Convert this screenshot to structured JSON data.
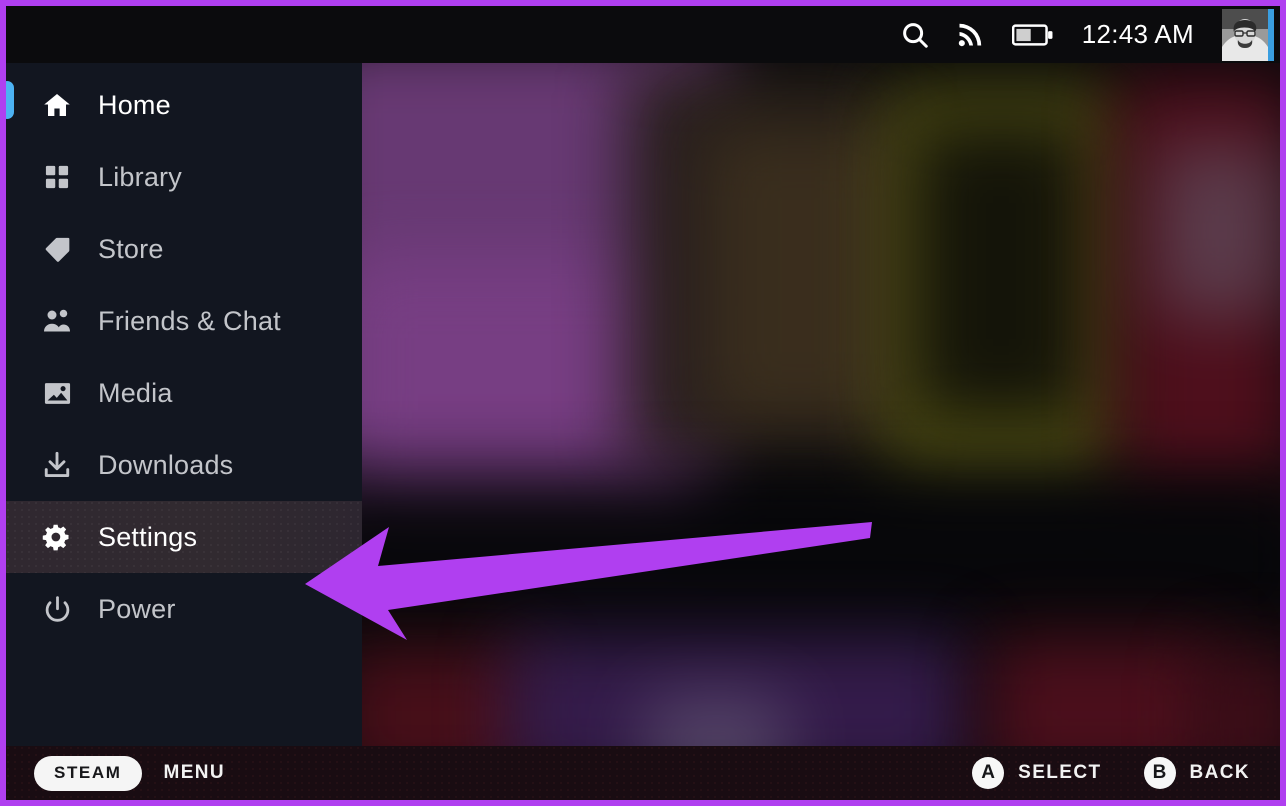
{
  "window": {
    "annotation_border_color": "#b03ff0"
  },
  "topbar": {
    "search_icon": "search-icon",
    "wifi_icon": "wifi-signal-icon",
    "battery_icon": "battery-icon",
    "battery_level_percent": 50,
    "clock": "12:43 AM",
    "avatar": "user-avatar",
    "avatar_status_color": "#3a9ee0"
  },
  "sidebar": {
    "focused_index": 0,
    "selected_index": 6,
    "focus_indicator_color": "#4cb2f2",
    "items": [
      {
        "label": "Home",
        "icon": "home-icon"
      },
      {
        "label": "Library",
        "icon": "grid-icon"
      },
      {
        "label": "Store",
        "icon": "tag-icon"
      },
      {
        "label": "Friends & Chat",
        "icon": "people-icon"
      },
      {
        "label": "Media",
        "icon": "image-icon"
      },
      {
        "label": "Downloads",
        "icon": "download-icon"
      },
      {
        "label": "Settings",
        "icon": "gear-icon"
      },
      {
        "label": "Power",
        "icon": "power-icon"
      }
    ]
  },
  "bottombar": {
    "steam_label": "STEAM",
    "menu_label": "MENU",
    "hints": [
      {
        "badge": "A",
        "label": "SELECT"
      },
      {
        "badge": "B",
        "label": "BACK"
      }
    ]
  },
  "annotation": {
    "arrow_color": "#b03ff0",
    "arrow_points_to": "Settings"
  },
  "background": {
    "description": "blurred Steam Deck home screen game artwork",
    "cards": [
      {
        "tint": "#6b3a77"
      },
      {
        "tint": "#3a2c1e"
      },
      {
        "tint": "#8a8a22"
      },
      {
        "tint": "#6e1020"
      },
      {
        "tint": "#4a1020"
      },
      {
        "tint": "#3e1f56"
      },
      {
        "tint": "#5c1020"
      }
    ]
  }
}
